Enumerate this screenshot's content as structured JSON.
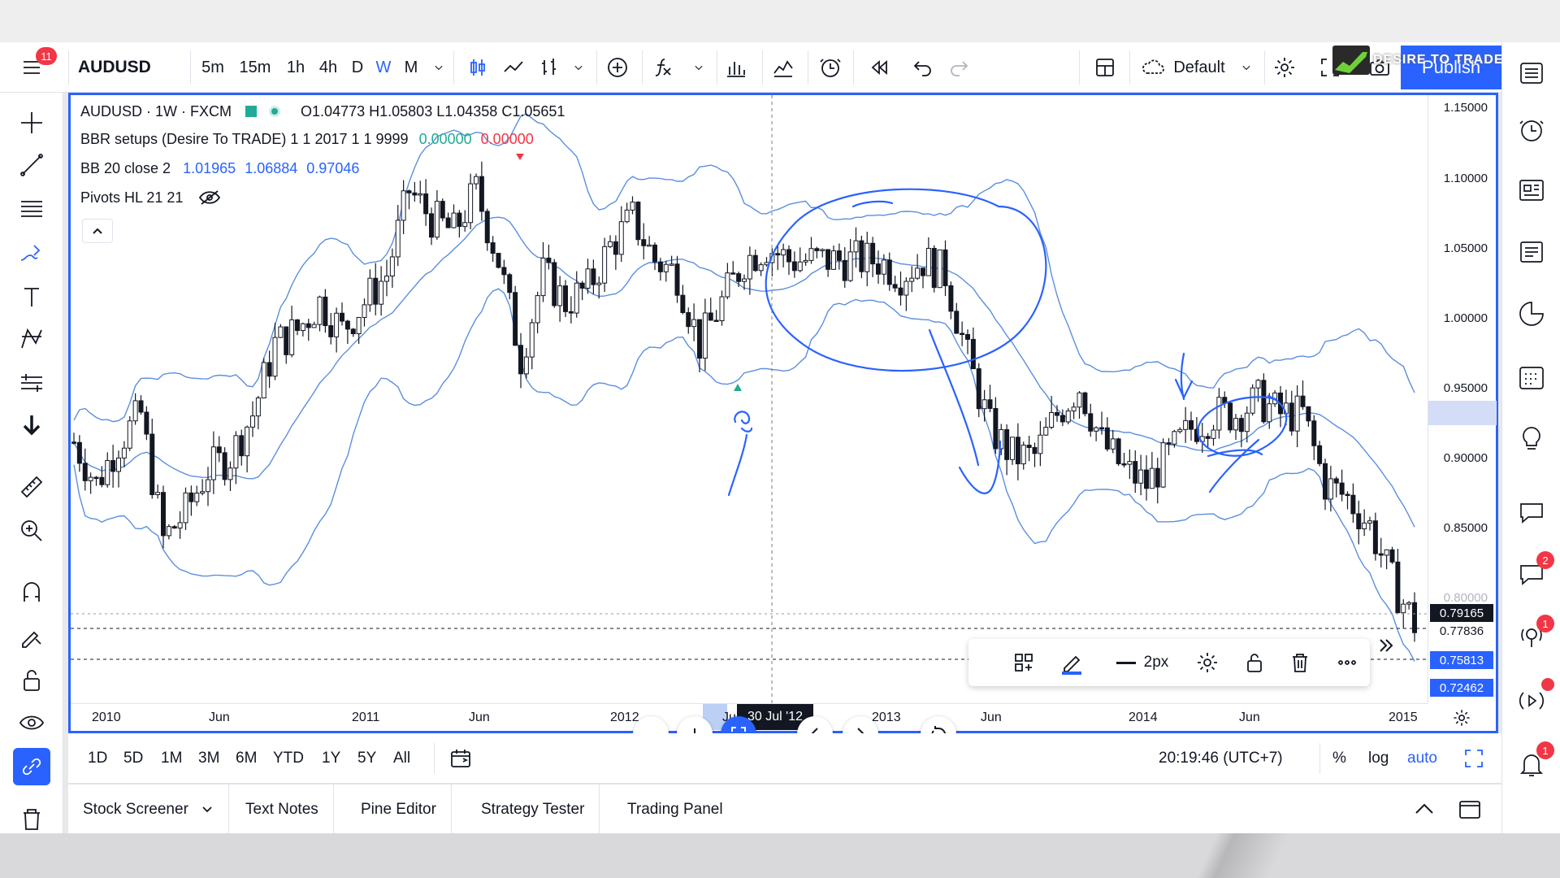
{
  "toolbar": {
    "menu_badge": "11",
    "symbol": "AUDUSD",
    "intervals": [
      "5m",
      "15m",
      "1h",
      "4h",
      "D",
      "W",
      "M"
    ],
    "active_interval": "W",
    "layout_name": "Default",
    "publish_label": "Publish",
    "logo_text": "DESIRE TO TRADE"
  },
  "legend": {
    "main": {
      "title": "AUDUSD · 1W · FXCM",
      "open": "O1.04773",
      "high": "H1.05803",
      "low": "L1.04358",
      "close": "C1.05651"
    },
    "ind1": {
      "name": "BBR setups (Desire To TRADE) 1 1 2017 1 1 9999",
      "v1": "0.00000",
      "v2": "0.00000"
    },
    "ind2": {
      "name": "BB 20 close 2",
      "v1": "1.01965",
      "v2": "1.06884",
      "v3": "0.97046"
    },
    "ind3": {
      "name": "Pivots HL 21 21"
    }
  },
  "price_axis": {
    "labels": [
      "1.15000",
      "1.10000",
      "1.05000",
      "1.00000",
      "0.95000",
      "0.90000",
      "0.85000",
      "0.80000"
    ],
    "tags": [
      {
        "text": "0.79165",
        "color": "#131722"
      },
      {
        "text": "0.77836",
        "color": "#ffffff"
      },
      {
        "text": "0.75813",
        "color": "#2962ff"
      },
      {
        "text": "0.72462",
        "color": "#2962ff"
      }
    ]
  },
  "time_axis": {
    "labels": [
      "2010",
      "Jun",
      "2011",
      "Jun",
      "2012",
      "Ju",
      "2013",
      "Jun",
      "2014",
      "Jun",
      "2015"
    ],
    "cursor_date": "30 Jul '12"
  },
  "draw_toolbar": {
    "width_label": "2px"
  },
  "range_bar": {
    "ranges": [
      "1D",
      "5D",
      "1M",
      "3M",
      "6M",
      "YTD",
      "1Y",
      "5Y",
      "All"
    ],
    "clock": "20:19:46 (UTC+7)",
    "percent": "%",
    "log": "log",
    "auto": "auto"
  },
  "tabs": [
    "Stock Screener",
    "Text Notes",
    "Pine Editor",
    "Strategy Tester",
    "Trading Panel"
  ],
  "right_bar": {
    "badges": [
      "2",
      "1",
      "1"
    ]
  },
  "colors": {
    "accent": "#2962ff",
    "up": "#22ab94",
    "down": "#f23645",
    "band": "#5b8fde",
    "candle": "#131722"
  },
  "chart_data": {
    "type": "candlestick",
    "symbol": "AUDUSD",
    "interval": "1W",
    "x_range": [
      "2010-01",
      "2015-01"
    ],
    "ylim": [
      0.72,
      1.15
    ],
    "close_path": [
      [
        "2010-01",
        0.91
      ],
      [
        "2010-02",
        0.88
      ],
      [
        "2010-03",
        0.91
      ],
      [
        "2010-04",
        0.93
      ],
      [
        "2010-05",
        0.84
      ],
      [
        "2010-06",
        0.86
      ],
      [
        "2010-07",
        0.89
      ],
      [
        "2010-08",
        0.9
      ],
      [
        "2010-09",
        0.93
      ],
      [
        "2010-10",
        0.98
      ],
      [
        "2010-11",
        0.99
      ],
      [
        "2010-12",
        1.01
      ],
      [
        "2011-01",
        0.99
      ],
      [
        "2011-02",
        1.01
      ],
      [
        "2011-03",
        1.03
      ],
      [
        "2011-04",
        1.09
      ],
      [
        "2011-05",
        1.07
      ],
      [
        "2011-06",
        1.06
      ],
      [
        "2011-07",
        1.09
      ],
      [
        "2011-08",
        1.04
      ],
      [
        "2011-09",
        0.97
      ],
      [
        "2011-10",
        1.03
      ],
      [
        "2011-11",
        1.01
      ],
      [
        "2011-12",
        1.02
      ],
      [
        "2012-01",
        1.05
      ],
      [
        "2012-02",
        1.07
      ],
      [
        "2012-03",
        1.04
      ],
      [
        "2012-04",
        1.03
      ],
      [
        "2012-05",
        0.98
      ],
      [
        "2012-06",
        1.01
      ],
      [
        "2012-07",
        1.04
      ],
      [
        "2012-08",
        1.05
      ],
      [
        "2012-09",
        1.04
      ],
      [
        "2012-10",
        1.04
      ],
      [
        "2012-11",
        1.04
      ],
      [
        "2012-12",
        1.04
      ],
      [
        "2013-01",
        1.04
      ],
      [
        "2013-02",
        1.03
      ],
      [
        "2013-03",
        1.04
      ],
      [
        "2013-04",
        1.03
      ],
      [
        "2013-05",
        0.97
      ],
      [
        "2013-06",
        0.92
      ],
      [
        "2013-07",
        0.9
      ],
      [
        "2013-08",
        0.9
      ],
      [
        "2013-09",
        0.93
      ],
      [
        "2013-10",
        0.95
      ],
      [
        "2013-11",
        0.91
      ],
      [
        "2013-12",
        0.89
      ],
      [
        "2014-01",
        0.88
      ],
      [
        "2014-02",
        0.9
      ],
      [
        "2014-03",
        0.92
      ],
      [
        "2014-04",
        0.93
      ],
      [
        "2014-05",
        0.93
      ],
      [
        "2014-06",
        0.94
      ],
      [
        "2014-07",
        0.93
      ],
      [
        "2014-08",
        0.93
      ],
      [
        "2014-09",
        0.88
      ],
      [
        "2014-10",
        0.87
      ],
      [
        "2014-11",
        0.85
      ],
      [
        "2014-12",
        0.81
      ],
      [
        "2015-01",
        0.78
      ]
    ]
  }
}
